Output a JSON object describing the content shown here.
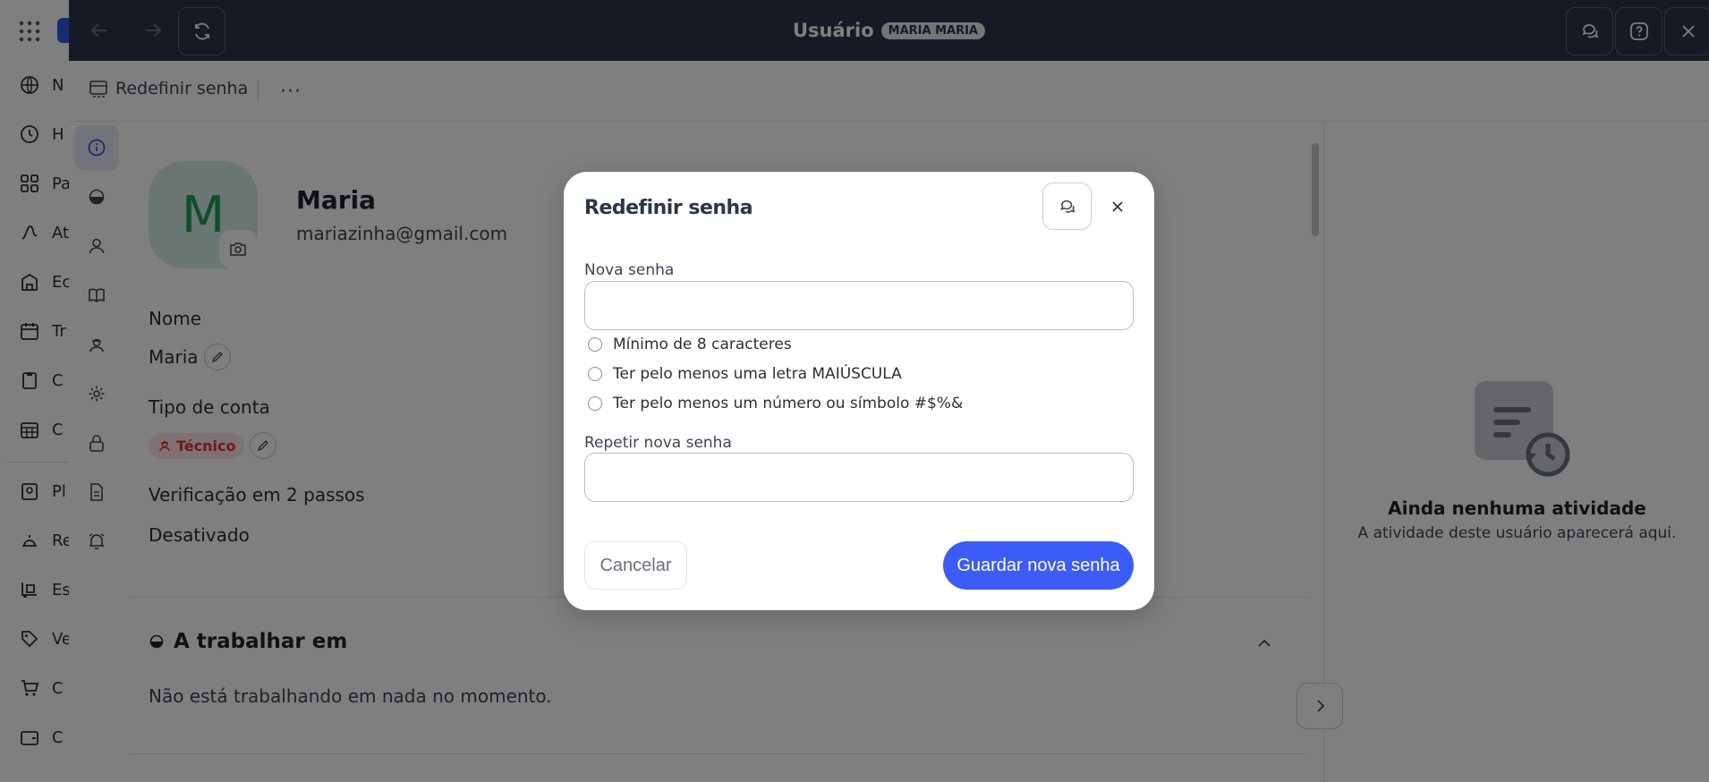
{
  "background_nav": {
    "items": [
      {
        "icon": "globe-icon",
        "label": "N"
      },
      {
        "icon": "clock-icon",
        "label": "H"
      },
      {
        "icon": "grid-icon",
        "label": "Pa"
      },
      {
        "icon": "activity-icon",
        "label": "At"
      },
      {
        "icon": "building-icon",
        "label": "Ec"
      },
      {
        "icon": "calendar-icon",
        "label": "Tr"
      },
      {
        "icon": "clipboard-icon",
        "label": "C"
      },
      {
        "icon": "calendar-grid-icon",
        "label": "C"
      },
      {
        "icon": "id-badge-icon",
        "label": "Pl"
      },
      {
        "icon": "service-bell-icon",
        "label": "Re"
      },
      {
        "icon": "dolly-icon",
        "label": "Es"
      },
      {
        "icon": "tag-icon",
        "label": "Ve"
      },
      {
        "icon": "cart-icon",
        "label": "C"
      },
      {
        "icon": "wallet-icon",
        "label": "C"
      }
    ]
  },
  "topbar": {
    "title": "Usuário",
    "badge": "MARIA MARIA"
  },
  "toolbar": {
    "reset_label": "Redefinir senha",
    "more_label": "···"
  },
  "profile": {
    "avatar_initial": "M",
    "name": "Maria",
    "email": "mariazinha@gmail.com",
    "name_label": "Nome",
    "name_value": "Maria",
    "account_type_label": "Tipo de conta",
    "account_type_value": "Técnico",
    "two_step_label": "Verificação em 2 passos",
    "two_step_value": "Desativado"
  },
  "working_section": {
    "title": "A trabalhar em",
    "empty_text": "Não está trabalhando em nada no momento."
  },
  "activity": {
    "title": "Ainda nenhuma atividade",
    "subtitle": "A atividade deste usuário aparecerá aqui."
  },
  "modal": {
    "title": "Redefinir senha",
    "new_password_label": "Nova senha",
    "new_password_value": "",
    "requirements": [
      "Mínimo de 8 caracteres",
      "Ter pelo menos uma letra MAIÚSCULA",
      "Ter pelo menos um número ou símbolo #$%&"
    ],
    "repeat_password_label": "Repetir nova senha",
    "repeat_password_value": "",
    "cancel_label": "Cancelar",
    "save_label": "Guardar nova senha"
  },
  "colors": {
    "topbar": "#2c3549",
    "accent": "#3b5cf6",
    "avatar_bg": "#d5ece2",
    "avatar_text": "#1e9e54",
    "badge_red": "#e03131"
  }
}
